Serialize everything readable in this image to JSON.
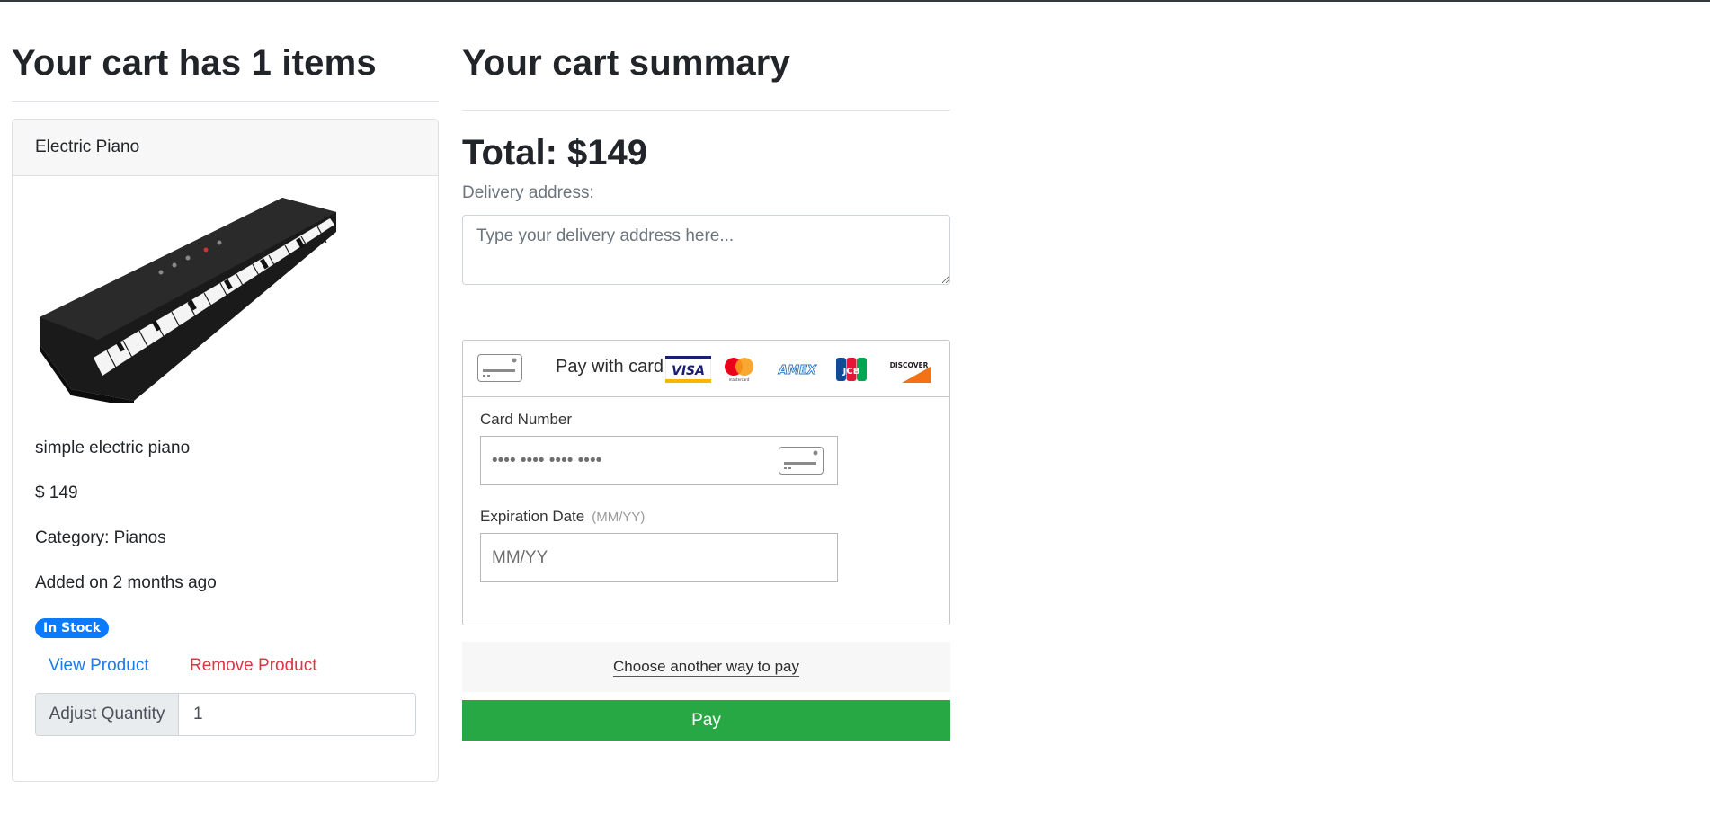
{
  "cart": {
    "heading": "Your cart has 1 items",
    "item": {
      "name": "Electric Piano",
      "description": "simple electric piano",
      "price": "$ 149",
      "category": "Category: Pianos",
      "added": "Added on 2 months ago",
      "stock_badge": "In Stock",
      "view_link": "View Product",
      "remove_link": "Remove Product",
      "quantity_label": "Adjust Quantity",
      "quantity_value": "1",
      "image_icon": "electric-piano-image"
    }
  },
  "summary": {
    "heading": "Your cart summary",
    "total": "Total: $149",
    "address_label": "Delivery address:",
    "address_placeholder": "Type your delivery address here...",
    "payment": {
      "pay_with_card": "Pay with card",
      "brands": [
        "VISA",
        "mastercard",
        "AMEX",
        "JCB",
        "DISCOVER"
      ],
      "card_number_label": "Card Number",
      "card_number_placeholder": "•••• •••• •••• ••••",
      "expiry_label": "Expiration Date",
      "expiry_hint": "(MM/YY)",
      "expiry_placeholder": "MM/YY",
      "other_way": "Choose another way to pay",
      "pay_button": "Pay"
    }
  },
  "colors": {
    "primary_badge": "#0a7bff",
    "link_blue": "#1e7ce8",
    "danger_red": "#dc3545",
    "pay_green": "#28a745"
  }
}
